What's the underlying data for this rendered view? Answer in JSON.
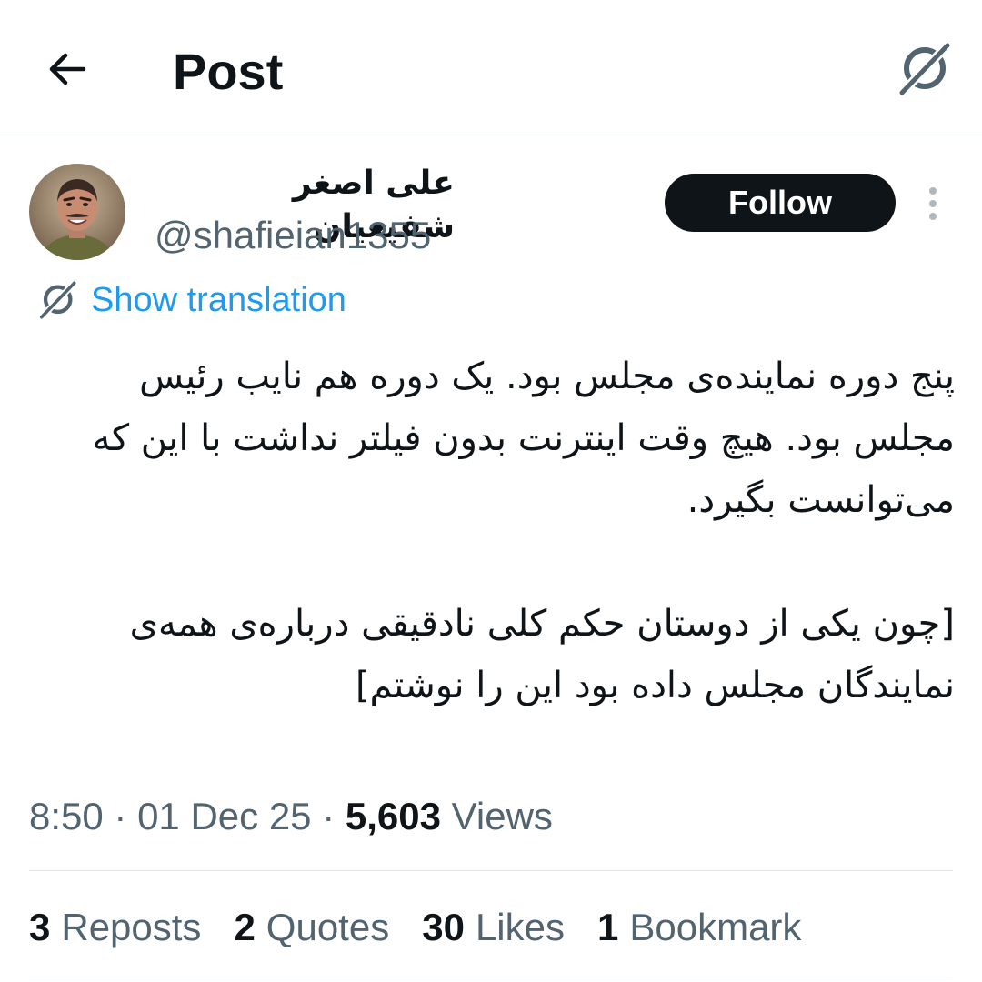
{
  "header": {
    "title": "Post",
    "back_icon": "arrow-left-icon",
    "translate_icon": "translate-icon"
  },
  "author": {
    "display_name": "علی اصغر شفیعیان",
    "handle": "@shafieian1355",
    "avatar": "avatar"
  },
  "actions": {
    "follow_label": "Follow",
    "more_icon": "more-vertical-icon"
  },
  "translation": {
    "label": "Show translation",
    "icon": "translate-icon"
  },
  "post": {
    "paragraph_1": "پنج دوره نماینده‌ی مجلس بود. یک دوره هم نایب رئیس مجلس بود. هیچ وقت اینترنت بدون فیلتر نداشت با این که می‌توانست بگیرد.",
    "paragraph_2": "[چون یکی از دوستان حکم کلی نادقیقی درباره‌ی همه‌ی نمایندگان مجلس داده بود این را نوشتم]"
  },
  "meta": {
    "time": "8:50",
    "date": "01 Dec 25",
    "views_count": "5,603",
    "views_label": "Views"
  },
  "stats": {
    "reposts_count": "3",
    "reposts_label": "Reposts",
    "quotes_count": "2",
    "quotes_label": "Quotes",
    "likes_count": "30",
    "likes_label": "Likes",
    "bookmarks_count": "1",
    "bookmarks_label": "Bookmark"
  },
  "colors": {
    "text_primary": "#0f1419",
    "text_secondary": "#536471",
    "link": "#1d9bf0",
    "divider": "#dfe6ea",
    "button_bg": "#0f1419"
  }
}
